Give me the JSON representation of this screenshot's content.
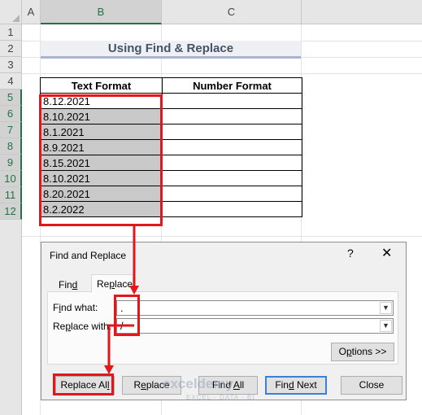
{
  "columns": [
    "A",
    "B",
    "C"
  ],
  "rows": [
    "1",
    "2",
    "3",
    "4",
    "5",
    "6",
    "7",
    "8",
    "9",
    "10",
    "11",
    "12"
  ],
  "title": "Using Find & Replace",
  "table": {
    "headers": [
      "Text Format",
      "Number Format"
    ],
    "rows": [
      {
        "text": "8.12.2021",
        "number": ""
      },
      {
        "text": "8.10.2021",
        "number": ""
      },
      {
        "text": "8.1.2021",
        "number": ""
      },
      {
        "text": "8.9.2021",
        "number": ""
      },
      {
        "text": "8.15.2021",
        "number": ""
      },
      {
        "text": "8.10.2021",
        "number": ""
      },
      {
        "text": "8.20.2021",
        "number": ""
      },
      {
        "text": "8.2.2022",
        "number": ""
      }
    ]
  },
  "dialog": {
    "title": "Find and Replace",
    "help": "?",
    "close": "✕",
    "tabs": [
      "Find",
      "Replace"
    ],
    "find_label": "Find what:",
    "find_value": ".",
    "replace_label": "Replace with:",
    "replace_value": "/",
    "options_button": "Options >>",
    "buttons": [
      "Replace All",
      "Replace",
      "Find All",
      "Find Next",
      "Close"
    ]
  },
  "watermark": {
    "name": "exceldemy",
    "tagline": "EXCEL · DATA · BI"
  },
  "colors": {
    "highlight": "#e3161b",
    "accent": "#217346",
    "selection": "#c9c9c9"
  }
}
